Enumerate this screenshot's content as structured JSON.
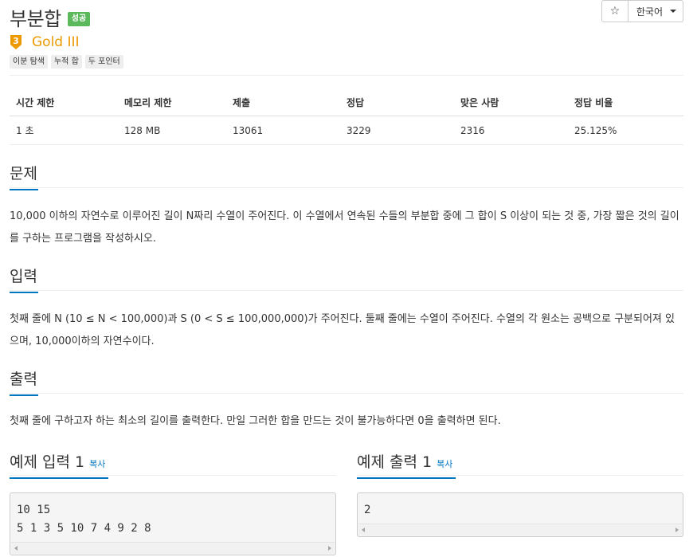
{
  "problem": {
    "title": "부분합",
    "status_badge": "성공",
    "tier_number": "3",
    "tier": "Gold III",
    "tags": [
      "이분 탐색",
      "누적 합",
      "두 포인터"
    ]
  },
  "controls": {
    "star_icon": "star-icon",
    "star_glyph": "☆",
    "language": "한국어"
  },
  "info_table": {
    "headers": [
      "시간 제한",
      "메모리 제한",
      "제출",
      "정답",
      "맞은 사람",
      "정답 비율"
    ],
    "row": [
      "1 초",
      "128 MB",
      "13061",
      "3229",
      "2316",
      "25.125%"
    ]
  },
  "sections": {
    "problem": {
      "heading": "문제",
      "text": "10,000 이하의 자연수로 이루어진 길이 N짜리 수열이 주어진다. 이 수열에서 연속된 수들의 부분합 중에 그 합이 S 이상이 되는 것 중, 가장 짧은 것의 길이를 구하는 프로그램을 작성하시오."
    },
    "input": {
      "heading": "입력",
      "text": "첫째 줄에 N (10 ≤ N < 100,000)과 S (0 < S ≤ 100,000,000)가 주어진다. 둘째 줄에는 수열이 주어진다. 수열의 각 원소는 공백으로 구분되어져 있으며, 10,000이하의 자연수이다."
    },
    "output": {
      "heading": "출력",
      "text": "첫째 줄에 구하고자 하는 최소의 길이를 출력한다. 만일 그러한 합을 만드는 것이 불가능하다면 0을 출력하면 된다."
    },
    "sample_input": {
      "heading": "예제 입력 1",
      "copy": "복사",
      "lines": [
        "10 15",
        "5 1 3 5 10 7 4 9 2 8"
      ]
    },
    "sample_output": {
      "heading": "예제 출력 1",
      "copy": "복사",
      "lines": [
        "2"
      ]
    }
  },
  "colors": {
    "accent": "#0076c0",
    "success": "#5cb85c",
    "gold": "#ec9a00"
  }
}
